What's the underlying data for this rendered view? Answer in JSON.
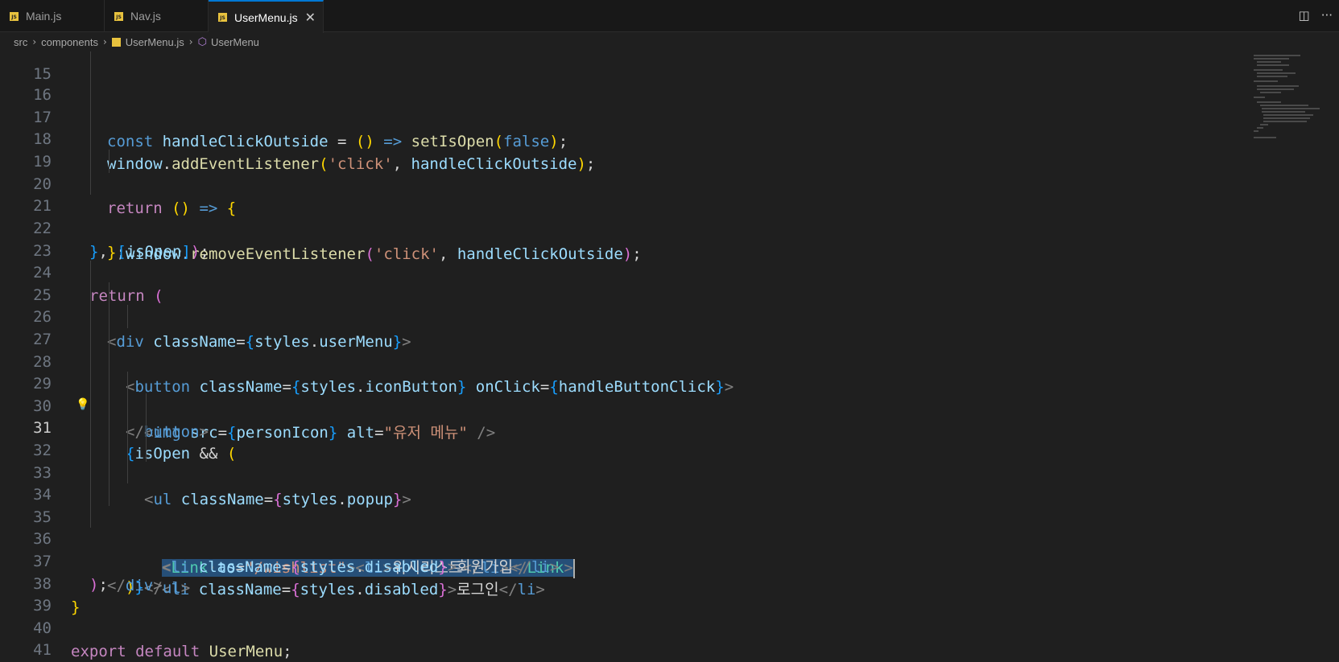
{
  "tabs": [
    {
      "label": "Main.js",
      "badge": "JS"
    },
    {
      "label": "Nav.js",
      "badge": "JS"
    },
    {
      "label": "UserMenu.js",
      "badge": "JS",
      "active": true
    }
  ],
  "breadcrumb": [
    "src",
    "components",
    "UserMenu.js",
    "UserMenu"
  ],
  "editor": {
    "current_line": "31",
    "lines": [
      "15",
      "16",
      "17",
      "18",
      "19",
      "20",
      "21",
      "22",
      "23",
      "24",
      "25",
      "26",
      "27",
      "28",
      "29",
      "30",
      "31",
      "32",
      "33",
      "34",
      "35",
      "36",
      "37",
      "38",
      "39",
      "40",
      "41"
    ],
    "code": {
      "l16": [
        "const",
        "handleClickOutside",
        "=",
        "(",
        ")",
        "=>",
        "setIsOpen",
        "(",
        "false",
        ")",
        ";"
      ],
      "l17": [
        "window",
        ".",
        "addEventListener",
        "(",
        "'click'",
        ", ",
        "handleClickOutside",
        ")",
        ";"
      ],
      "l19": [
        "return",
        "(",
        ")",
        "=>",
        "{"
      ],
      "l20": [
        "window",
        ".",
        "removeEventListener",
        "(",
        "'click'",
        ", ",
        "handleClickOutside",
        ")",
        ";"
      ],
      "l21": [
        "}",
        ";"
      ],
      "l22": [
        "}",
        ", ",
        "[",
        "isOpen",
        "]",
        ")",
        ";"
      ],
      "l24": [
        "return",
        "("
      ],
      "l25": [
        "<",
        "div",
        "className",
        "=",
        "{",
        "styles",
        ".",
        "userMenu",
        "}",
        ">"
      ],
      "l26": [
        "<",
        "button",
        "className",
        "=",
        "{",
        "styles",
        ".",
        "iconButton",
        "}",
        "onClick",
        "=",
        "{",
        "handleButtonClick",
        "}",
        ">"
      ],
      "l27": [
        "<",
        "img",
        "src",
        "=",
        "{",
        "personIcon",
        "}",
        "alt",
        "=",
        "\"유저 메뉴\"",
        "/>"
      ],
      "l28": [
        "</",
        "button",
        ">"
      ],
      "l29": [
        "{",
        "isOpen",
        "&&",
        "("
      ],
      "l30": [
        "<",
        "ul",
        "className",
        "=",
        "{",
        "styles",
        ".",
        "popup",
        "}",
        ">"
      ],
      "l31": [
        "<",
        "Link",
        "to",
        "=",
        "\"/wishlist\"",
        ">",
        "<",
        "li",
        ">",
        "위시리스트",
        "</",
        "li",
        "></",
        "Link",
        ">"
      ],
      "l32": [
        "<",
        "li",
        "className",
        "=",
        "{",
        "styles",
        ".",
        "disabled",
        "}",
        ">",
        "회원가입",
        "</",
        "li",
        ">"
      ],
      "l33": [
        "<",
        "li",
        "className",
        "=",
        "{",
        "styles",
        ".",
        "disabled",
        "}",
        ">",
        "로그인",
        "</",
        "li",
        ">"
      ],
      "l34": [
        "</",
        "ul",
        ">"
      ],
      "l35": [
        ")",
        "}"
      ],
      "l36": [
        "</",
        "div",
        ">"
      ],
      "l37": [
        ")",
        ";"
      ],
      "l38": [
        "}"
      ],
      "l40": [
        "export",
        "default",
        "UserMenu",
        ";"
      ]
    }
  },
  "icons": {
    "tab_file": "javascript-file-icon",
    "breadcrumb_symbol": "symbol-function-icon",
    "split_editor": "split-editor-icon",
    "more_actions": "more-actions-icon",
    "lightbulb": "lightbulb-icon"
  },
  "colors": {
    "editor_bg": "#1f1f1f",
    "selection": "#264f78",
    "active_tab_border": "#0078d4",
    "js_badge": "#e8c23e"
  }
}
